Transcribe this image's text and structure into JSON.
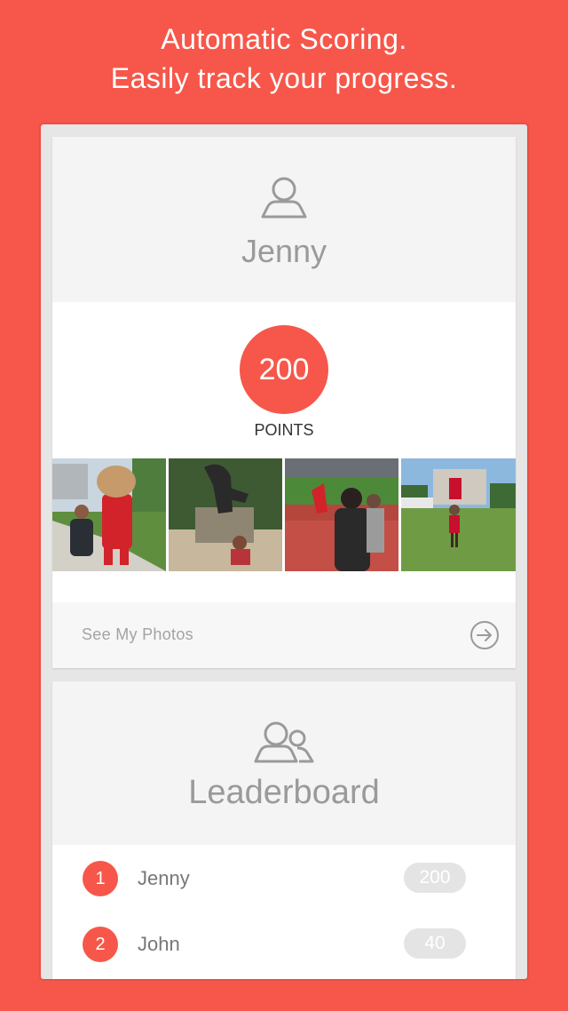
{
  "headline": {
    "line1": "Automatic Scoring.",
    "line2": "Easily track your progress."
  },
  "profile": {
    "icon": "user-icon",
    "name": "Jenny",
    "points_value": "200",
    "points_label": "POINTS",
    "photos": [
      {
        "name": "photo-mascot"
      },
      {
        "name": "photo-statue"
      },
      {
        "name": "photo-stadium"
      },
      {
        "name": "photo-campus-lawn"
      }
    ],
    "see_photos_label": "See My Photos",
    "arrow_icon": "arrow-right-circle-icon"
  },
  "leaderboard": {
    "icon": "users-icon",
    "title": "Leaderboard",
    "rows": [
      {
        "rank": "1",
        "name": "Jenny",
        "score": "200"
      },
      {
        "rank": "2",
        "name": "John",
        "score": "40"
      }
    ]
  },
  "colors": {
    "accent": "#f6574a",
    "badge": "#e4e4e4",
    "muted_text": "#9a9a9a"
  }
}
